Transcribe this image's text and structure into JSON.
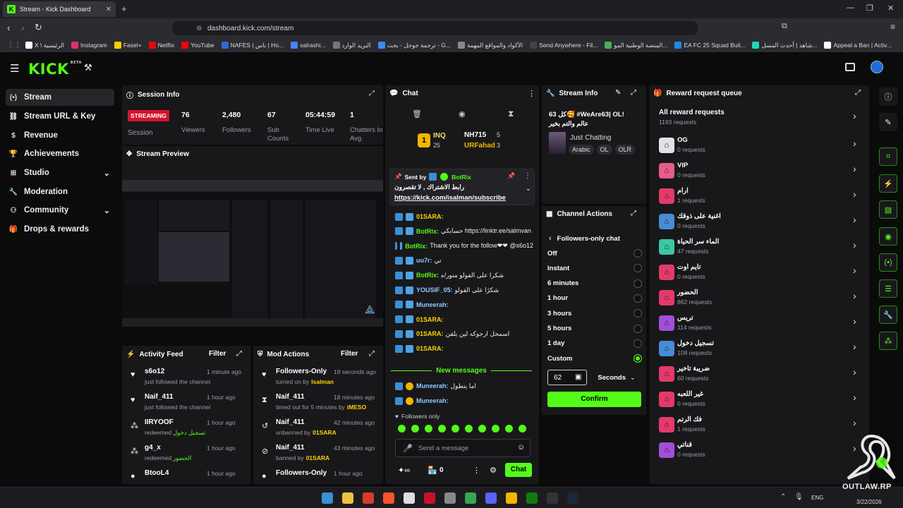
{
  "browser": {
    "tab_title": "Stream - Kick Dashboard",
    "url": "dashboard.kick.com/stream",
    "bookmarks": [
      "X \\ الرئيسية",
      "Instagram",
      "Fasel+",
      "Netflix",
      "YouTube",
      "NAFES | ناس | Ho...",
      "salrashi...",
      "البريد الوارد",
      "ترجمة جوجل - بحث - G...",
      "الأكواد والمواقع المهمة",
      "Send Anywhere - Fil...",
      "المنصة الوطنية المو...",
      "EA FC 25 Squad Buil...",
      "شاهد | أحدث المسل...",
      "Appeal a Ban | Activ..."
    ]
  },
  "brand": {
    "logo": "KICK",
    "beta": "BETA",
    "accent": "#53fc18"
  },
  "sidebar": {
    "items": [
      {
        "label": "Stream",
        "icon": "broadcast-icon"
      },
      {
        "label": "Stream URL & Key",
        "icon": "link-icon"
      },
      {
        "label": "Revenue",
        "icon": "dollar-icon"
      },
      {
        "label": "Achievements",
        "icon": "trophy-icon"
      },
      {
        "label": "Studio",
        "icon": "grid-icon"
      },
      {
        "label": "Moderation",
        "icon": "wrench-icon"
      },
      {
        "label": "Community",
        "icon": "people-icon"
      },
      {
        "label": "Drops & rewards",
        "icon": "gift-icon"
      }
    ]
  },
  "session": {
    "title": "Session Info",
    "status": "STREAMING",
    "session_label": "Session",
    "stats": [
      {
        "value": "76",
        "label": "Viewers"
      },
      {
        "value": "2,480",
        "label": "Followers"
      },
      {
        "value": "67",
        "label": "Sub Counts"
      },
      {
        "value": "05:44:59",
        "label": "Time Live"
      },
      {
        "value": "1",
        "label": "Chatters In Avg."
      }
    ]
  },
  "preview": {
    "title": "Stream Preview",
    "watermark": "OUTLAW.RP"
  },
  "activity": {
    "title": "Activity Feed",
    "filter": "Filter",
    "items": [
      {
        "user": "s6o12",
        "time": "1 minute ago",
        "detail": "just followed the channel",
        "extra": ""
      },
      {
        "user": "Naif_411",
        "time": "1 hour ago",
        "detail": "just followed the channel",
        "extra": ""
      },
      {
        "user": "IIRYOOF",
        "time": "1 hour ago",
        "detail": "redeemed",
        "extra": "تسجيل دخول"
      },
      {
        "user": "g4_x",
        "time": "1 hour ago",
        "detail": "redeemed",
        "extra": "الحضور"
      },
      {
        "user": "BtooL4",
        "time": "1 hour ago",
        "detail": "",
        "extra": ""
      }
    ]
  },
  "modactions": {
    "title": "Mod Actions",
    "filter": "Filter",
    "items": [
      {
        "action": "Followers-Only",
        "time": "19 seconds ago",
        "detail": "turned on by",
        "who": "Isalman"
      },
      {
        "action": "Naif_411",
        "time": "18 minutes ago",
        "detail": "timed out for 5 minutes by",
        "who": "iMESO"
      },
      {
        "action": "Naif_411",
        "time": "42 minutes ago",
        "detail": "unbanned by",
        "who": "01SARA"
      },
      {
        "action": "Naif_411",
        "time": "43 minutes ago",
        "detail": "banned by",
        "who": "01SARA"
      },
      {
        "action": "Followers-Only",
        "time": "1 hour ago",
        "detail": "",
        "who": ""
      }
    ]
  },
  "chat": {
    "title": "Chat",
    "top": {
      "rank1": "INQ",
      "rank1_n": "25",
      "rank2": "NH715",
      "rank2_n": "5",
      "rank3": "URFahad",
      "rank3_n": "3"
    },
    "pinned": {
      "sent_by": "Sent by",
      "bot": "BotRix",
      "text": "رابط الاشتراك , لا تقصرون",
      "link": "https://kick.com/isalman/subscribe"
    },
    "messages": [
      {
        "user": "01SARA:",
        "text": "",
        "color": "#ffd400"
      },
      {
        "user": "BotRix:",
        "text": "حسابكي https://linktr.ee/salmvan",
        "color": "#53fc18"
      },
      {
        "user": "BotRix:",
        "text": "Thank you for the follow❤❤ @s6o12",
        "color": "#53fc18"
      },
      {
        "user": "uu7r:",
        "text": "تي",
        "color": "#8ecbff"
      },
      {
        "user": "BotRix:",
        "text": "شكرا على الفولو منور/ه",
        "color": "#53fc18"
      },
      {
        "user": "YOUSIF_05:",
        "text": "شكرًا على الفولو",
        "color": "#8ecbff"
      },
      {
        "user": "Muneerah:",
        "text": "",
        "color": "#8ecbff"
      },
      {
        "user": "01SARA:",
        "text": "",
        "color": "#ffd400"
      },
      {
        "user": "01SARA:",
        "text": "اسمحل ارجوكه لين يلقن",
        "color": "#ffd400"
      },
      {
        "user": "01SARA:",
        "text": "",
        "color": "#ffd400"
      }
    ],
    "new_messages": "New messages",
    "new": [
      {
        "user": "Muneerah:",
        "text": "اما يتطول",
        "color": "#8ecbff"
      },
      {
        "user": "Muneerah:",
        "text": "",
        "color": "#8ecbff"
      }
    ],
    "followers_only": "Followers only",
    "placeholder": "Send a message",
    "points": "0",
    "send": "Chat"
  },
  "streaminfo": {
    "title": "Stream Info",
    "stream_title": "كل 63🥰 #WeAre63| OL!",
    "stream_sub": "عالم والتم بخير",
    "category": "Just Chatting",
    "tags": [
      "Arabic",
      "OL",
      "OLR"
    ]
  },
  "channel": {
    "title": "Channel Actions",
    "back": "Followers-only chat",
    "options": [
      "Off",
      "Instant",
      "6 minutes",
      "1 hour",
      "3 hours",
      "5 hours",
      "1 day",
      "Custom"
    ],
    "selected": "Custom",
    "custom_value": "62",
    "unit": "Seconds",
    "confirm": "Confirm"
  },
  "rewards": {
    "title": "Reward request queue",
    "all": "All reward requests",
    "all_count": "1193 requests",
    "items": [
      {
        "name": "OG",
        "count": "0 requests",
        "color": "#e4e0e6"
      },
      {
        "name": "VIP",
        "count": "0 requests",
        "color": "#e85b8a"
      },
      {
        "name": "ارام",
        "count": "1 requests",
        "color": "#e43a6a"
      },
      {
        "name": "اغنية على ذوقك",
        "count": "0 requests",
        "color": "#4a8bd6"
      },
      {
        "name": "الماء سر الحياة",
        "count": "47 requests",
        "color": "#39c7a4"
      },
      {
        "name": "تايم اوت",
        "count": "0 requests",
        "color": "#e43a6a"
      },
      {
        "name": "الحضور",
        "count": "862 requests",
        "color": "#e43a6a"
      },
      {
        "name": "تريس",
        "count": "114 requests",
        "color": "#a24ed8"
      },
      {
        "name": "تسجيل دخول",
        "count": "108 requests",
        "color": "#4a8bd6"
      },
      {
        "name": "ضريبة تاخير",
        "count": "60 requests",
        "color": "#e43a6a"
      },
      {
        "name": "غير اللعبه",
        "count": "0 requests",
        "color": "#e43a6a"
      },
      {
        "name": "فك الرتم",
        "count": "1 requests",
        "color": "#e43a6a"
      },
      {
        "name": "قناتي",
        "count": "0 requests",
        "color": "#a24ed8"
      }
    ]
  },
  "taskbar": {
    "lang": "ENG",
    "date": "3/22/2026"
  }
}
